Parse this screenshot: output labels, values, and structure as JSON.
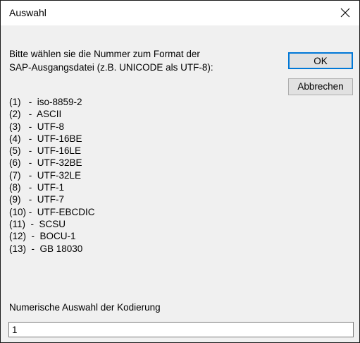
{
  "window": {
    "title": "Auswahl",
    "close_icon": "close-icon"
  },
  "prompt": {
    "text": "Bitte wählen sie die Nummer zum Format der\nSAP-Ausgangsdatei (z.B. UNICODE als UTF-8):"
  },
  "buttons": {
    "ok_label": "OK",
    "cancel_label": "Abbrechen"
  },
  "options": [
    "(1)   -  iso-8859-2",
    "(2)   -  ASCII",
    "(3)   -  UTF-8",
    "(4)   -  UTF-16BE",
    "(5)   -  UTF-16LE",
    "(6)   -  UTF-32BE",
    "(7)   -  UTF-32LE",
    "(8)   -  UTF-1",
    "(9)   -  UTF-7",
    "(10) -  UTF-EBCDIC",
    "(11)  -  SCSU",
    "(12)  -  BOCU-1",
    "(13)  -  GB 18030"
  ],
  "input": {
    "label": "Numerische Auswahl der Kodierung",
    "value": "1"
  },
  "colors": {
    "focus_border": "#0078d7",
    "dialog_background": "#f0f0f0"
  }
}
